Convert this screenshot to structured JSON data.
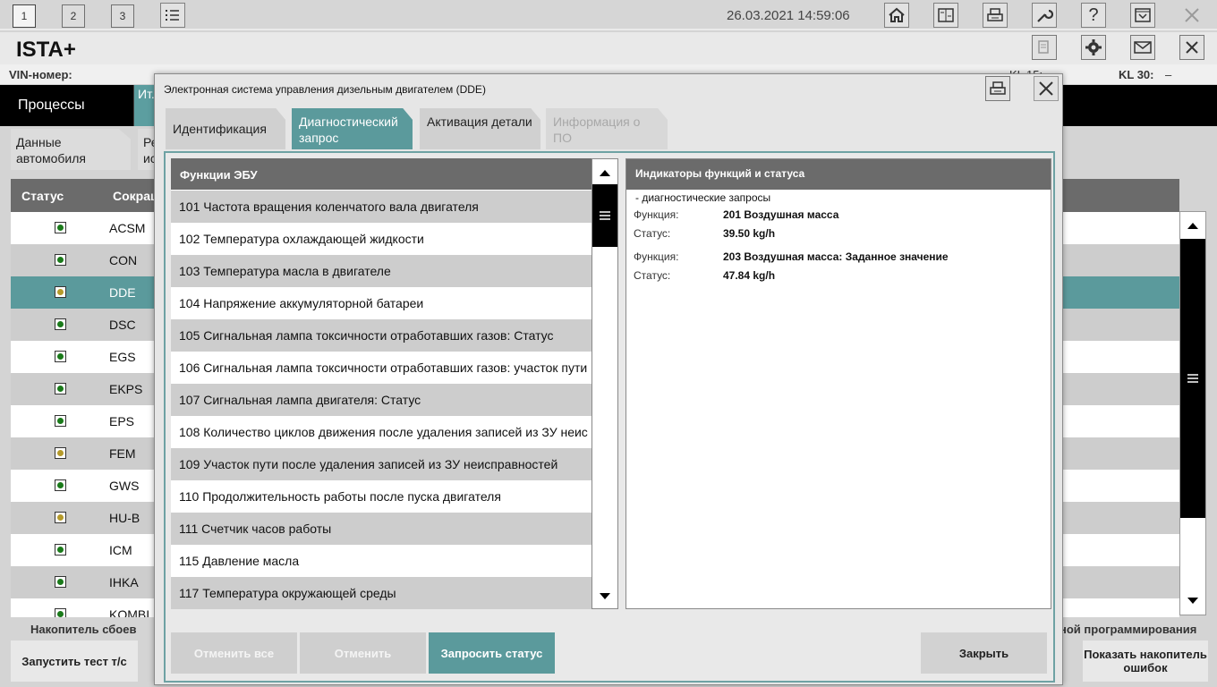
{
  "topbar": {
    "tabs": [
      "1",
      "2",
      "3"
    ],
    "datetime": "26.03.2021 14:59:06",
    "icons": [
      "list-icon",
      "home-icon",
      "vehicle-data-icon",
      "print-icon",
      "wrench-icon",
      "help-icon",
      "download-icon",
      "close-icon"
    ],
    "help_glyph": "?"
  },
  "app": {
    "title": "ISTA+",
    "vin_label": "VIN-номер:",
    "kl15_label": "KL 15:",
    "kl30_label": "KL 30:",
    "kl30_value": "–"
  },
  "mainnav": {
    "processes": "Процессы",
    "tab2": "Ит..."
  },
  "subtabs": {
    "vehicle_data": "Данные автомобиля",
    "tab2": "Ре... ис..."
  },
  "bgtable": {
    "col_status": "Статус",
    "col_abbr": "Сокращ",
    "rows": [
      {
        "abbr": "ACSM",
        "led": "green"
      },
      {
        "abbr": "CON",
        "led": "green"
      },
      {
        "abbr": "DDE",
        "led": "yellow"
      },
      {
        "abbr": "DSC",
        "led": "green"
      },
      {
        "abbr": "EGS",
        "led": "green"
      },
      {
        "abbr": "EKPS",
        "led": "green"
      },
      {
        "abbr": "EPS",
        "led": "green"
      },
      {
        "abbr": "FEM",
        "led": "yellow"
      },
      {
        "abbr": "GWS",
        "led": "green"
      },
      {
        "abbr": "HU-B",
        "led": "yellow"
      },
      {
        "abbr": "ICM",
        "led": "green"
      },
      {
        "abbr": "IHKA",
        "led": "green"
      },
      {
        "abbr": "KOMBI",
        "led": "green"
      }
    ]
  },
  "bgbottom": {
    "fault_memory": "Накопитель сбоев",
    "programming": "ной программирования",
    "start_test": "Запустить тест т/с",
    "show_fault_memory": "Показать накопитель ошибок"
  },
  "dialog": {
    "title": "Электронная система управления дизельным двигателем (DDE)",
    "tabs": [
      {
        "label": "Идентификация",
        "state": "normal"
      },
      {
        "label": "Диагностический запрос",
        "state": "active"
      },
      {
        "label": "Активация детали",
        "state": "normal"
      },
      {
        "label": "Информация о ПО",
        "state": "disabled"
      }
    ],
    "functions_header": "Функции ЭБУ",
    "functions": [
      "101 Частота вращения коленчатого вала двигателя",
      "102 Температура охлаждающей жидкости",
      "103 Температура масла в двигателе",
      "104 Напряжение аккумуляторной батареи",
      "105 Сигнальная лампа токсичности отработавших газов: Статус",
      "106 Сигнальная лампа токсичности отработавших газов: участок пути",
      "107 Сигнальная лампа двигателя: Статус",
      "108 Количество циклов движения после удаления записей из ЗУ неис",
      "109 Участок пути после удаления записей из ЗУ неисправностей",
      "110 Продолжительность работы после пуска двигателя",
      "111 Счетчик часов работы",
      "115 Давление масла",
      "117 Температура окружающей среды"
    ],
    "status_header": "Индикаторы функций и статуса",
    "status_section": "- диагностические запросы",
    "status_entries": [
      {
        "func_label": "Функция:",
        "func_value": "201 Воздушная масса",
        "status_label": "Статус:",
        "status_value": "39.50 kg/h"
      },
      {
        "func_label": "Функция:",
        "func_value": "203 Воздушная масса: Заданное значение",
        "status_label": "Статус:",
        "status_value": "47.84 kg/h"
      }
    ],
    "buttons": {
      "cancel_all": "Отменить все",
      "cancel": "Отменить",
      "request_status": "Запросить статус",
      "close": "Закрыть"
    }
  },
  "colors": {
    "teal_accent": "#5b9a9c",
    "header_gray": "#6b6b6b",
    "led_green": "#1a7a1a",
    "led_yellow": "#b59a2a"
  }
}
